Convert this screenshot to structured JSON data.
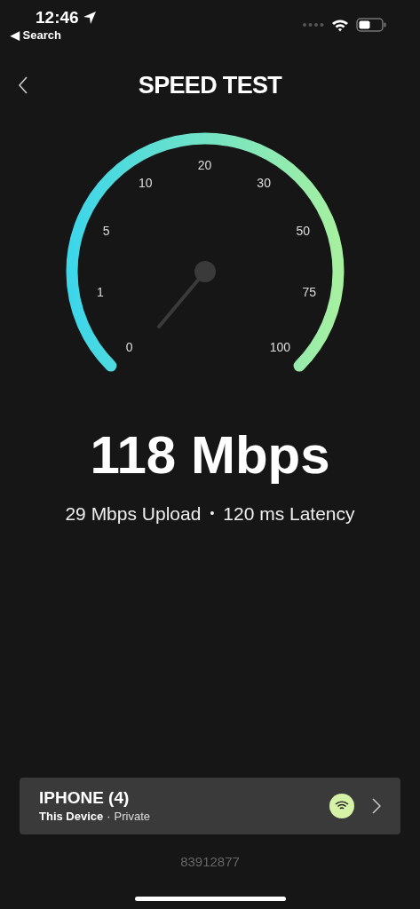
{
  "status_bar": {
    "time": "12:46",
    "back_label": "◀ Search"
  },
  "header": {
    "title": "SPEED TEST"
  },
  "gauge": {
    "scale_labels": [
      "0",
      "1",
      "5",
      "10",
      "20",
      "30",
      "50",
      "75",
      "100"
    ]
  },
  "result": {
    "speed": "118 Mbps",
    "upload": "29 Mbps Upload",
    "separator": "•",
    "latency": "120 ms Latency"
  },
  "device": {
    "name": "IPHONE (4)",
    "role": "This Device",
    "separator": "·",
    "network": "Private"
  },
  "footer": {
    "code": "83912877"
  }
}
